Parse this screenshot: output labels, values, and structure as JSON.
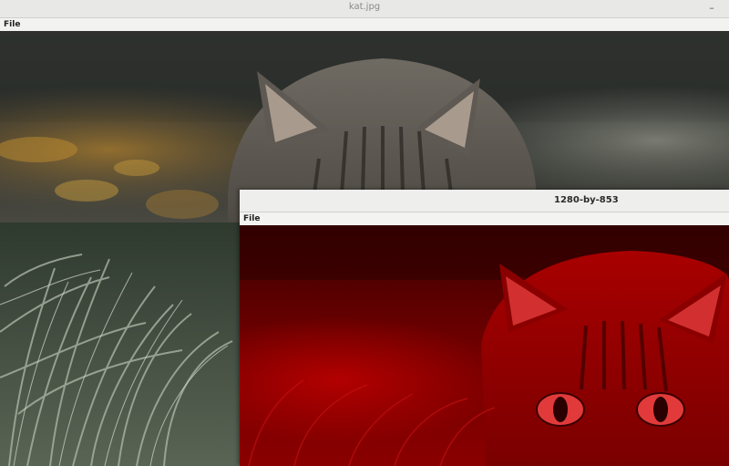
{
  "main_window": {
    "title": "kat.jpg",
    "minimize_glyph": "–",
    "menu": {
      "file_label": "File"
    },
    "image": {
      "subject": "tabby-cat-in-frosty-grass",
      "channel": "full-color"
    }
  },
  "second_window": {
    "title": "1280-by-853",
    "menu": {
      "file_label": "File"
    },
    "image": {
      "subject": "tabby-cat-in-frosty-grass",
      "channel": "red"
    }
  },
  "colors": {
    "titlebar": "#e8e8e7",
    "menubar": "#f2f2f1",
    "red_channel": "#c00000"
  }
}
